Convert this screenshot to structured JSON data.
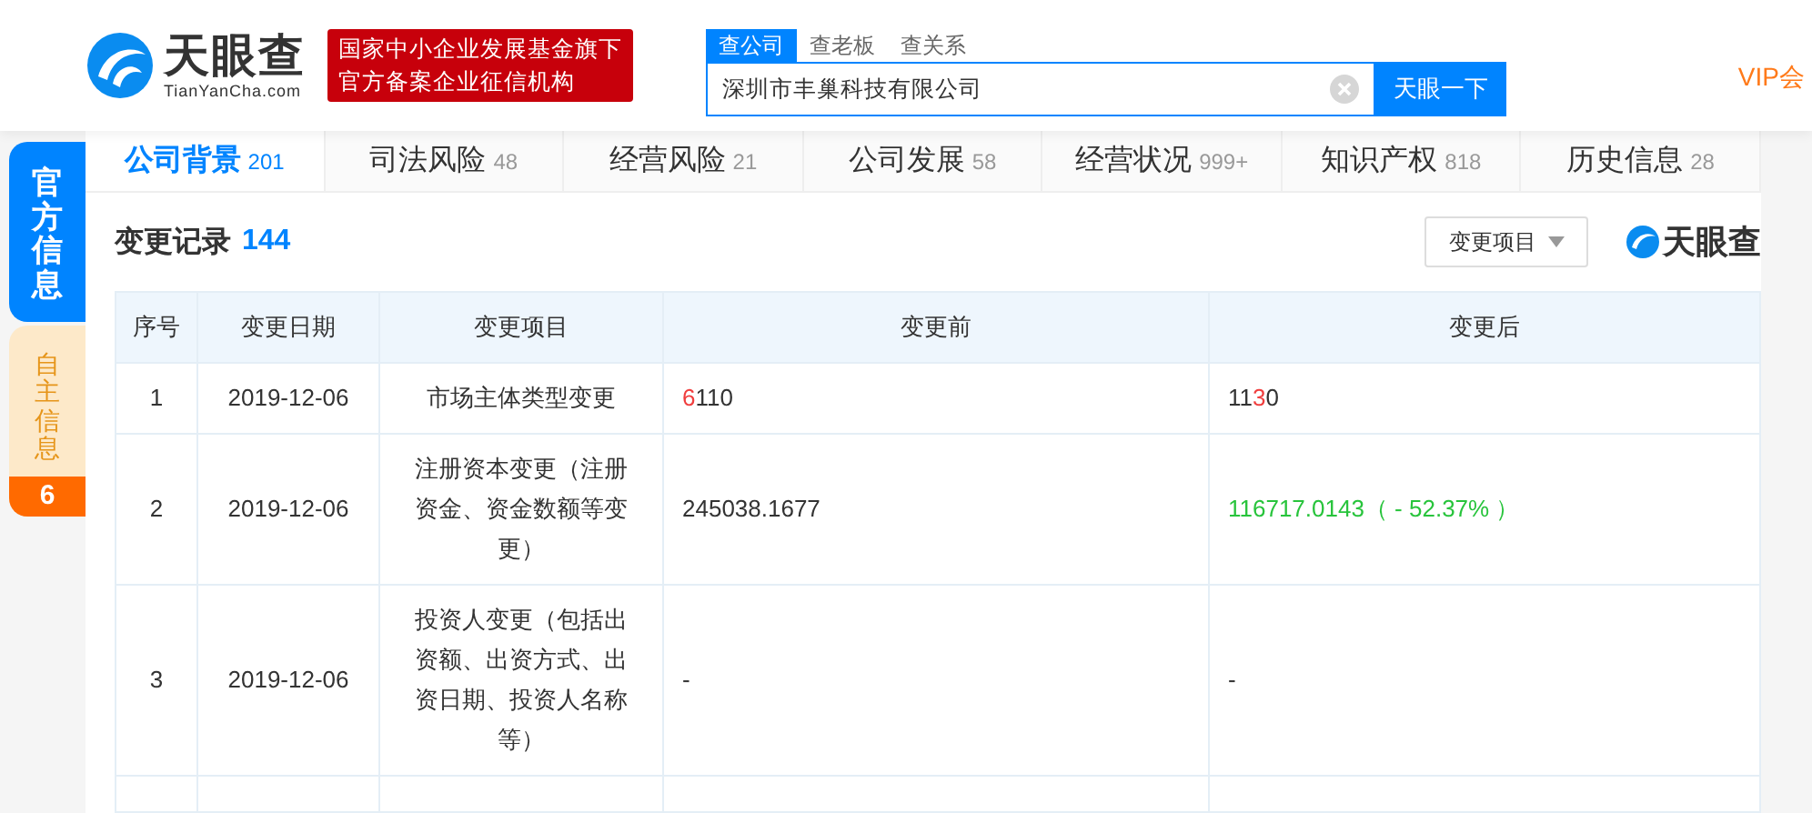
{
  "header": {
    "logo": {
      "name": "天眼查",
      "domain": "TianYanCha.com"
    },
    "badge": [
      "国家中小企业发展基金旗下",
      "官方备案企业征信机构"
    ],
    "search_tabs": [
      {
        "label": "查公司",
        "selected": true
      },
      {
        "label": "查老板",
        "selected": false
      },
      {
        "label": "查关系",
        "selected": false
      }
    ],
    "search": {
      "value": "深圳市丰巢科技有限公司",
      "button": "天眼一下"
    },
    "vip": "VIP会"
  },
  "side_tabs": [
    {
      "label": "官方信息",
      "selected": true
    },
    {
      "label": "自主信息",
      "selected": false,
      "count": "6"
    }
  ],
  "tabs": [
    {
      "label": "公司背景",
      "count": "201",
      "selected": true
    },
    {
      "label": "司法风险",
      "count": "48",
      "selected": false
    },
    {
      "label": "经营风险",
      "count": "21",
      "selected": false
    },
    {
      "label": "公司发展",
      "count": "58",
      "selected": false
    },
    {
      "label": "经营状况",
      "count": "999+",
      "selected": false
    },
    {
      "label": "知识产权",
      "count": "818",
      "selected": false
    },
    {
      "label": "历史信息",
      "count": "28",
      "selected": false
    }
  ],
  "section": {
    "title": "变更记录",
    "count": "144",
    "filter": "变更项目",
    "brand": "天眼查"
  },
  "table": {
    "columns": [
      "序号",
      "变更日期",
      "变更项目",
      "变更前",
      "变更后"
    ],
    "rows": [
      {
        "index": "1",
        "date": "2019-12-06",
        "item": "市场主体类型变更",
        "before": [
          {
            "text": "6",
            "changed": true
          },
          {
            "text": "110",
            "changed": false
          }
        ],
        "after": [
          {
            "text": "11",
            "changed": false
          },
          {
            "text": "3",
            "changed": true
          },
          {
            "text": "0",
            "changed": false
          }
        ],
        "decreased": false
      },
      {
        "index": "2",
        "date": "2019-12-06",
        "item": "注册资本变更（注册资金、资金数额等变更）",
        "before": [
          {
            "text": "245038.1677",
            "changed": false
          }
        ],
        "after": [
          {
            "text": "116717.0143（ - 52.37% ）",
            "changed": false
          }
        ],
        "decreased": true
      },
      {
        "index": "3",
        "date": "2019-12-06",
        "item": "投资人变更（包括出资额、出资方式、出资日期、投资人名称等）",
        "before": [
          {
            "text": "-",
            "changed": false
          }
        ],
        "after": [
          {
            "text": "-",
            "changed": false
          }
        ],
        "decreased": false
      }
    ]
  }
}
